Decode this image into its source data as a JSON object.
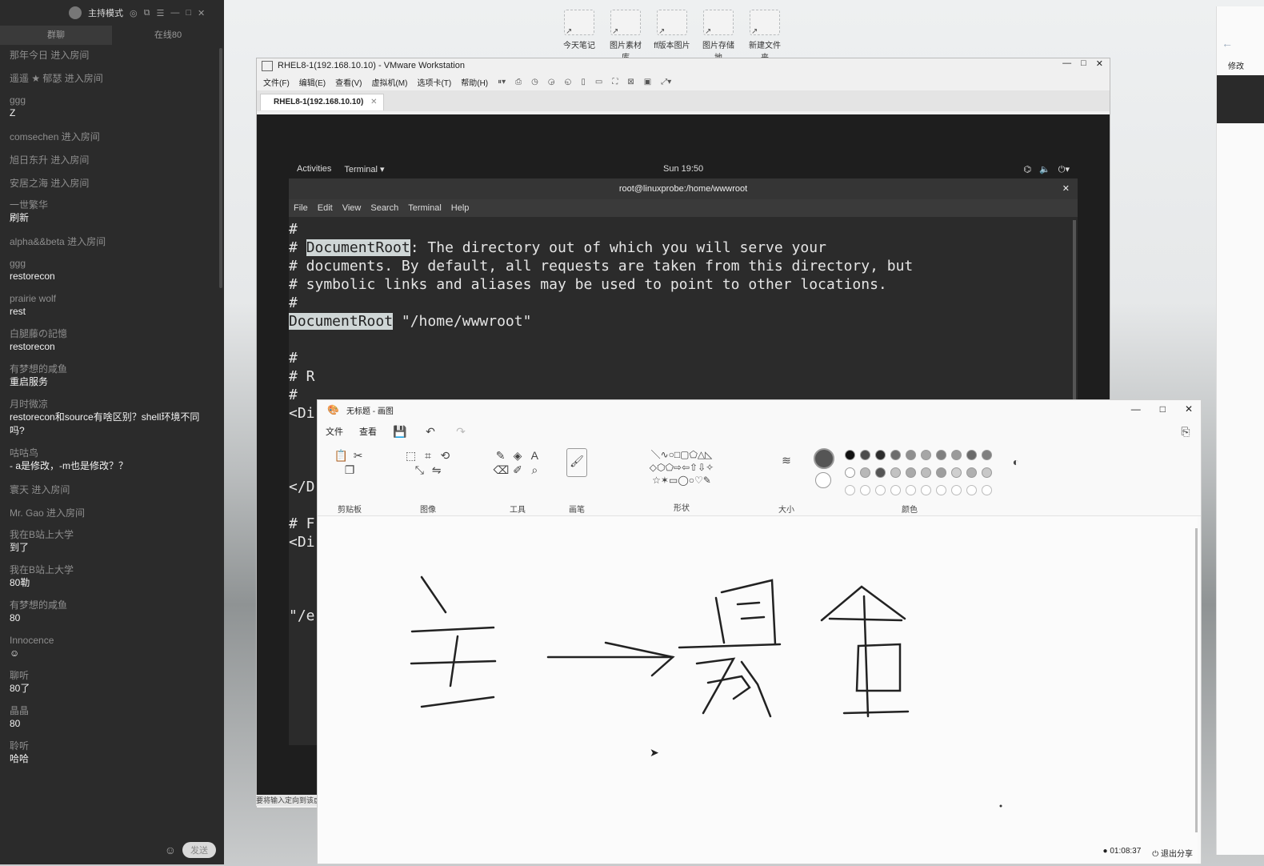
{
  "chat": {
    "title": "主持模式",
    "tabs": [
      "群聊",
      "在线80"
    ],
    "send_label": "发送",
    "messages": [
      {
        "user": "那年今日",
        "text": "",
        "join": "进入房间"
      },
      {
        "user": "遥遥 ★ 郁瑟",
        "text": "",
        "join": "进入房间"
      },
      {
        "user": "ggg",
        "text": "Z",
        "join": ""
      },
      {
        "user": "comsechen",
        "text": "",
        "join": "进入房间"
      },
      {
        "user": "旭日东升",
        "text": "",
        "join": "进入房间"
      },
      {
        "user": "安居之海",
        "text": "",
        "join": "进入房间"
      },
      {
        "user": "一世繁华",
        "text": "刷新",
        "join": ""
      },
      {
        "user": "alpha&&beta",
        "text": "",
        "join": "进入房间"
      },
      {
        "user": "ggg",
        "text": "restorecon",
        "join": ""
      },
      {
        "user": "prairie wolf",
        "text": "rest",
        "join": ""
      },
      {
        "user": "白腿藤の記憶",
        "text": "restorecon",
        "join": ""
      },
      {
        "user": "有梦想的咸鱼",
        "text": "重启服务",
        "join": ""
      },
      {
        "user": "月时微凉",
        "text": "restorecon和source有啥区别？shell环境不同吗?",
        "join": ""
      },
      {
        "user": "咕咕鸟",
        "text": " - a是修改，-m也是修改？？",
        "join": ""
      },
      {
        "user": "寰天",
        "text": "",
        "join": "进入房间"
      },
      {
        "user": "Mr. Gao",
        "text": "",
        "join": "进入房间"
      },
      {
        "user": "我在B站上大学",
        "text": "到了",
        "join": ""
      },
      {
        "user": "我在B站上大学",
        "text": "80勒",
        "join": ""
      },
      {
        "user": "有梦想的咸鱼",
        "text": "80",
        "join": ""
      },
      {
        "user": "Innocence",
        "text": "☺",
        "join": ""
      },
      {
        "user": "聊听",
        "text": "80了",
        "join": ""
      },
      {
        "user": "晶晶",
        "text": "80",
        "join": ""
      },
      {
        "user": "聆听",
        "text": "哈哈",
        "join": ""
      }
    ]
  },
  "desktop": {
    "icons": [
      "今天笔记",
      "图片素材库",
      "ff版本图片",
      "图片存储地",
      "新建文件夹"
    ]
  },
  "vmware": {
    "title": "RHEL8-1(192.168.10.10) - VMware Workstation",
    "menu": [
      "文件(F)",
      "编辑(E)",
      "查看(V)",
      "虚拟机(M)",
      "选项卡(T)",
      "帮助(H)"
    ],
    "tab": "RHEL8-1(192.168.10.10)",
    "status": "要将输入定向到该虚拟机",
    "gnome": {
      "activities": "Activities",
      "app": "Terminal ▾",
      "clock": "Sun 19:50"
    },
    "terminal": {
      "title": "root@linuxprobe:/home/wwwroot",
      "menu": [
        "File",
        "Edit",
        "View",
        "Search",
        "Terminal",
        "Help"
      ],
      "lines": [
        {
          "pre": "#",
          "hl": "",
          "post": ""
        },
        {
          "pre": "# ",
          "hl": "DocumentRoot",
          "post": ": The directory out of which you will serve your"
        },
        {
          "pre": "# documents. By default, all requests are taken from this directory, but",
          "hl": "",
          "post": ""
        },
        {
          "pre": "# symbolic links and aliases may be used to point to other locations.",
          "hl": "",
          "post": ""
        },
        {
          "pre": "#",
          "hl": "",
          "post": ""
        },
        {
          "pre": "",
          "hl": "DocumentRoot",
          "post": " \"/home/wwwroot\""
        },
        {
          "pre": "",
          "hl": "",
          "post": ""
        },
        {
          "pre": "#",
          "hl": "",
          "post": ""
        },
        {
          "pre": "# R",
          "hl": "",
          "post": ""
        },
        {
          "pre": "#",
          "hl": "",
          "post": ""
        },
        {
          "pre": "<Di",
          "hl": "",
          "post": ""
        },
        {
          "pre": "",
          "hl": "",
          "post": ""
        },
        {
          "pre": "",
          "hl": "",
          "post": ""
        },
        {
          "pre": "",
          "hl": "",
          "post": ""
        },
        {
          "pre": "</D",
          "hl": "",
          "post": ""
        },
        {
          "pre": "",
          "hl": "",
          "post": ""
        },
        {
          "pre": "# F",
          "hl": "",
          "post": ""
        },
        {
          "pre": "<Di",
          "hl": "",
          "post": ""
        },
        {
          "pre": "",
          "hl": "",
          "post": ""
        },
        {
          "pre": "",
          "hl": "",
          "post": ""
        },
        {
          "pre": "",
          "hl": "",
          "post": ""
        },
        {
          "pre": "\"/e",
          "hl": "",
          "post": ""
        }
      ]
    }
  },
  "paint": {
    "title": "无标题 - 画图",
    "menu": [
      "文件",
      "查看"
    ],
    "groups": [
      "剪贴板",
      "图像",
      "工具",
      "画笔",
      "形状",
      "大小",
      "颜色"
    ],
    "status": {
      "timer": "01:08:37",
      "share": "退出分享"
    },
    "colors_row1": [
      "#111111",
      "#4d4d4d",
      "#2c2c2c",
      "#6d6d6d",
      "#8f8f8f",
      "#a6a6a6",
      "#7f7f7f",
      "#9a9a9a",
      "#6a6a6a",
      "#808080"
    ],
    "colors_row2": [
      "#ffffff",
      "#b8b8b8",
      "#555555",
      "#c2c2c2",
      "#aaaaaa",
      "#bdbdbd",
      "#9e9e9e",
      "#cfcfcf",
      "#b0b0b0",
      "#c8c8c8"
    ],
    "accent": "#1e1e1e"
  },
  "browser_sliver": {
    "text": "修改"
  }
}
